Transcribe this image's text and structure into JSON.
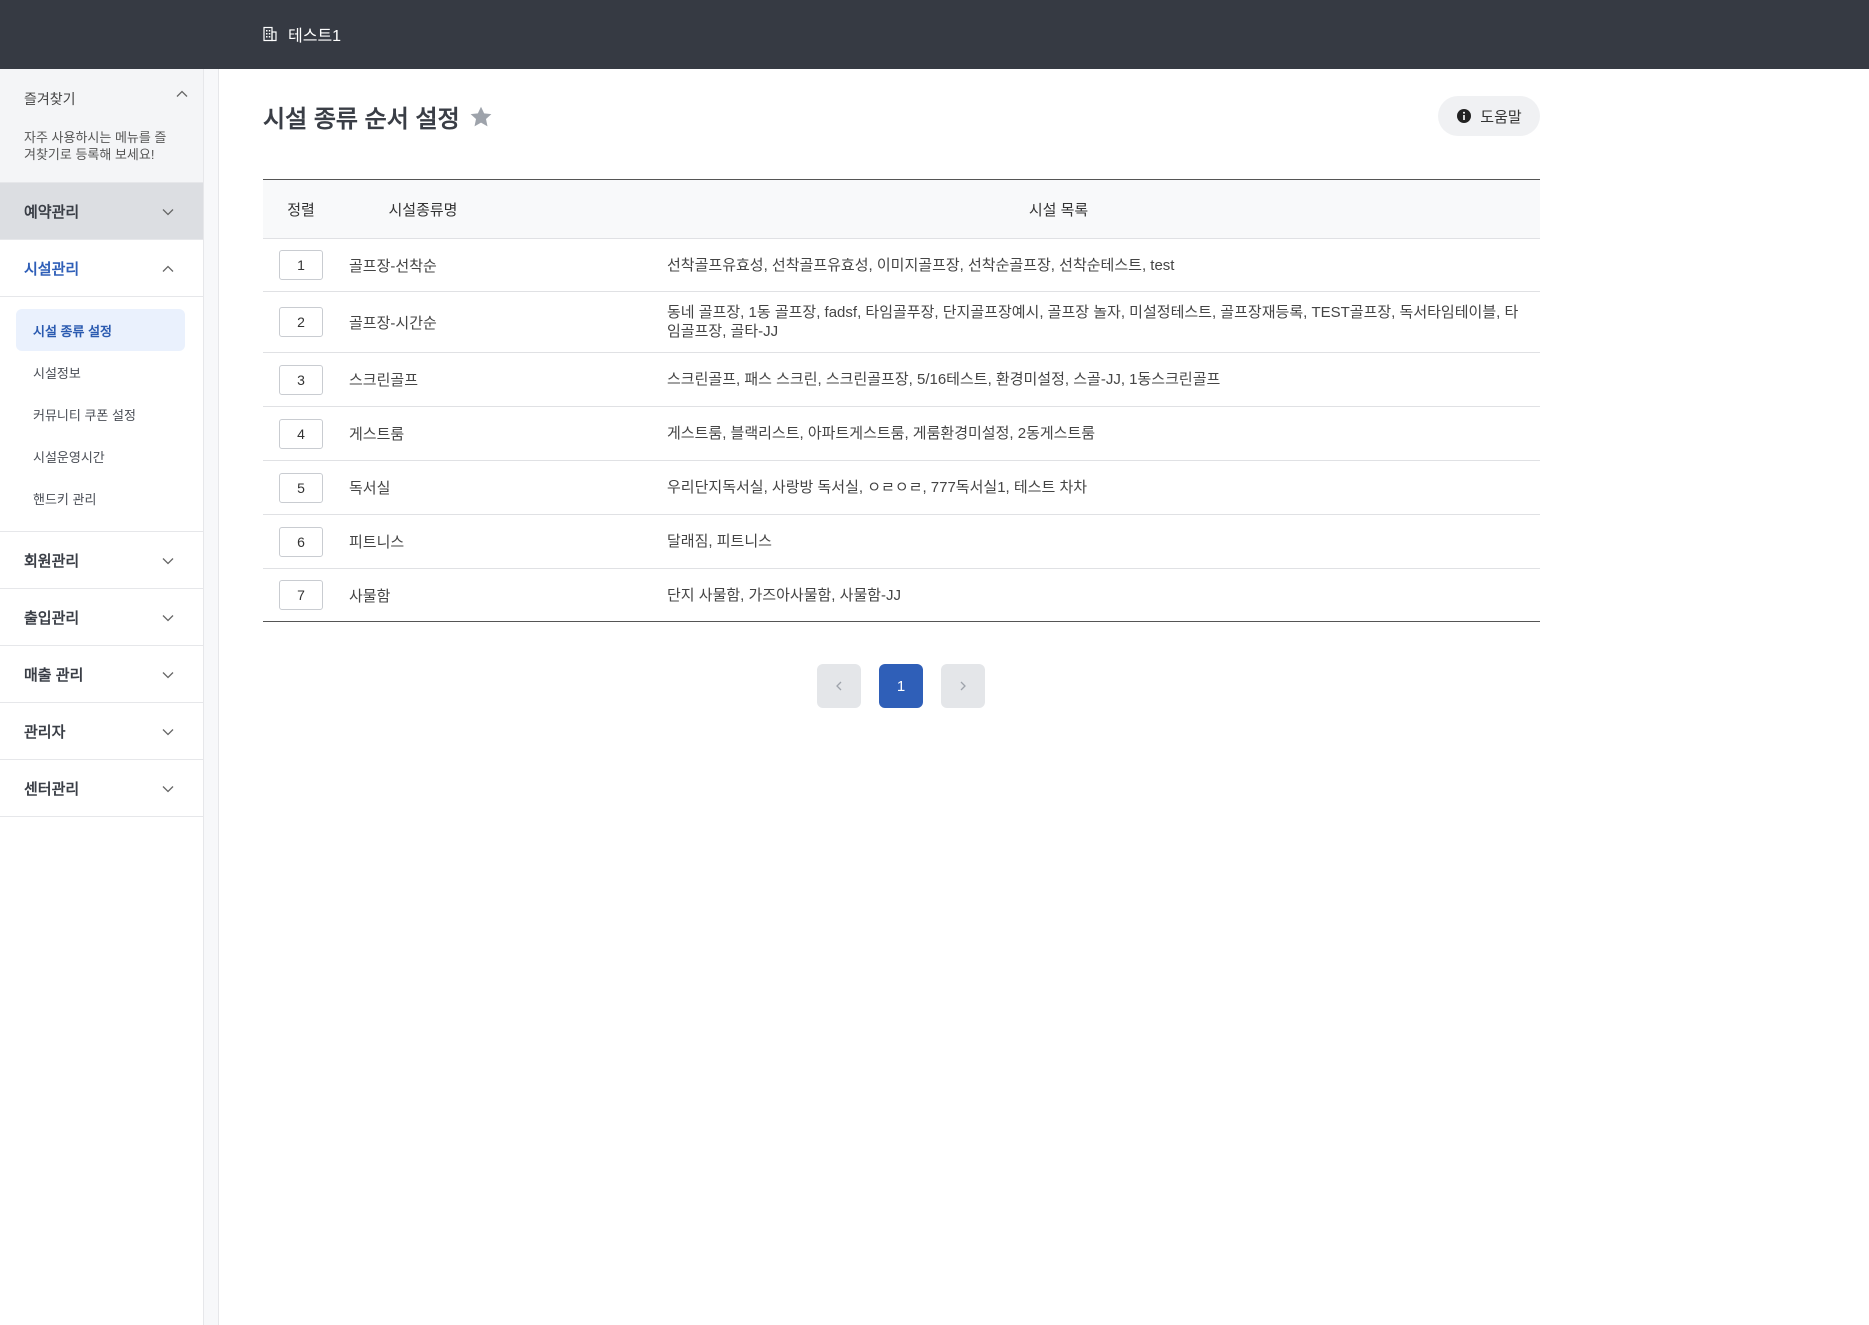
{
  "topbar": {
    "site_name": "테스트1",
    "site_icon": "building-icon"
  },
  "sidebar": {
    "favorites": {
      "title": "즐겨찾기",
      "description": "자주 사용하시는 메뉴를 즐겨찾기로 등록해 보세요!"
    },
    "groups": [
      {
        "label": "예약관리",
        "state": "collapsed"
      },
      {
        "label": "시설관리",
        "state": "expanded"
      },
      {
        "label": "회원관리",
        "state": "collapsed"
      },
      {
        "label": "출입관리",
        "state": "collapsed"
      },
      {
        "label": "매출 관리",
        "state": "collapsed"
      },
      {
        "label": "관리자",
        "state": "collapsed"
      },
      {
        "label": "센터관리",
        "state": "collapsed"
      }
    ],
    "facility_items": [
      {
        "label": "시설 종류 설정",
        "active": true
      },
      {
        "label": "시설정보",
        "active": false
      },
      {
        "label": "커뮤니티 쿠폰 설정",
        "active": false
      },
      {
        "label": "시설운영시간",
        "active": false
      },
      {
        "label": "핸드키 관리",
        "active": false
      }
    ]
  },
  "page": {
    "title": "시설 종류 순서 설정",
    "help_label": "도움말"
  },
  "table": {
    "headers": {
      "order": "정렬",
      "name": "시설종류명",
      "list": "시설 목록"
    },
    "rows": [
      {
        "order": "1",
        "name": "골프장-선착순",
        "list": "선착골프유효성, 선착골프유효성, 이미지골프장, 선착순골프장, 선착순테스트, test"
      },
      {
        "order": "2",
        "name": "골프장-시간순",
        "list": "동네 골프장, 1동 골프장, fadsf, 타임골푸장, 단지골프장예시, 골프장 놀자, 미설정테스트, 골프장재등록, TEST골프장, 독서타임테이블, 타임골프장, 골타-JJ"
      },
      {
        "order": "3",
        "name": "스크린골프",
        "list": "스크린골프, 패스 스크린, 스크린골프장, 5/16테스트, 환경미설정, 스골-JJ, 1동스크린골프"
      },
      {
        "order": "4",
        "name": "게스트룸",
        "list": "게스트룸, 블랙리스트, 아파트게스트룸, 게룸환경미설정, 2동게스트룸"
      },
      {
        "order": "5",
        "name": "독서실",
        "list": "우리단지독서실, 사랑방 독서실, ㅇㄹㅇㄹ, 777독서실1, 테스트 차차"
      },
      {
        "order": "6",
        "name": "피트니스",
        "list": "달래짐, 피트니스"
      },
      {
        "order": "7",
        "name": "사물함",
        "list": "단지 사물함, 가즈아사물함, 사물함-JJ"
      }
    ]
  },
  "pagination": {
    "current_page": "1"
  },
  "colors": {
    "topbar_bg": "#363a43",
    "accent": "#2f5fb8",
    "active_item_bg": "#eaf1fd"
  }
}
